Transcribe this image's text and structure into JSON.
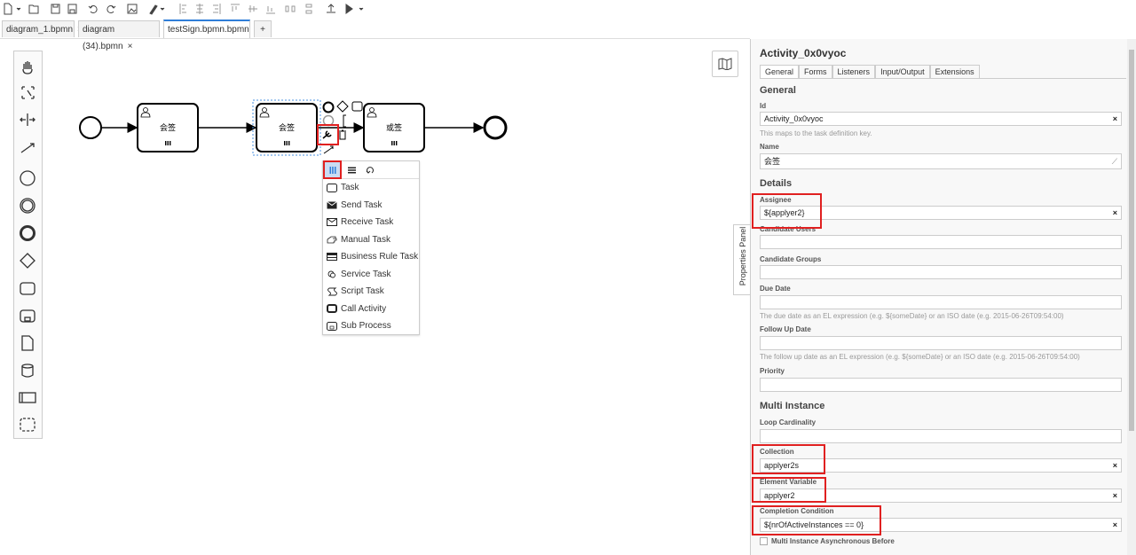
{
  "toolbar": {
    "icons": [
      "new-file-icon",
      "chevron-down-icon",
      "open-folder-icon",
      "save-icon",
      "save-as-icon",
      "undo-icon",
      "redo-icon",
      "export-image-icon",
      "edit-tool-icon",
      "chevron-down-icon",
      "align-left-icon",
      "align-center-icon",
      "align-right-icon",
      "align-top-icon",
      "align-middle-icon",
      "align-bottom-icon",
      "distribute-horizontal-icon",
      "distribute-vertical-icon",
      "deploy-icon",
      "run-icon",
      "chevron-down-icon"
    ]
  },
  "tabs": [
    {
      "label": "diagram_1.bpmn",
      "close": "×"
    },
    {
      "label": "diagram (34).bpmn",
      "close": "×"
    },
    {
      "label": "testSign.bpmn.bpmn",
      "close": "×"
    }
  ],
  "add_tab": "+",
  "palette": [
    "hand-tool-icon",
    "lasso-tool-icon",
    "space-tool-icon",
    "connect-tool-icon",
    "start-event-icon",
    "intermediate-event-icon",
    "end-event-icon",
    "gateway-icon",
    "task-icon",
    "subprocess-icon",
    "data-object-icon",
    "data-store-icon",
    "pool-icon",
    "group-icon"
  ],
  "diagram": {
    "tasks": [
      {
        "label": "会签"
      },
      {
        "label": "会签"
      },
      {
        "label": "或签"
      }
    ]
  },
  "replace_menu": {
    "toggles": [
      "parallel-multi-instance-icon",
      "sequential-multi-instance-icon",
      "loop-icon"
    ],
    "items": [
      {
        "label": "Task",
        "icon": "task-icon"
      },
      {
        "label": "Send Task",
        "icon": "send-task-icon"
      },
      {
        "label": "Receive Task",
        "icon": "receive-task-icon"
      },
      {
        "label": "Manual Task",
        "icon": "manual-task-icon"
      },
      {
        "label": "Business Rule Task",
        "icon": "business-rule-task-icon"
      },
      {
        "label": "Service Task",
        "icon": "service-task-icon"
      },
      {
        "label": "Script Task",
        "icon": "script-task-icon"
      },
      {
        "label": "Call Activity",
        "icon": "call-activity-icon"
      },
      {
        "label": "Sub Process",
        "icon": "sub-process-icon"
      }
    ]
  },
  "properties_toggle": "Properties Panel",
  "panel": {
    "title": "Activity_0x0vyoc",
    "tabs": [
      "General",
      "Forms",
      "Listeners",
      "Input/Output",
      "Extensions"
    ],
    "general": {
      "heading": "General",
      "id_label": "Id",
      "id_value": "Activity_0x0vyoc",
      "id_hint": "This maps to the task definition key.",
      "name_label": "Name",
      "name_value": "会签"
    },
    "details": {
      "heading": "Details",
      "assignee_label": "Assignee",
      "assignee_value": "${applyer2}",
      "candidate_users_label": "Candidate Users",
      "candidate_users_value": "",
      "candidate_groups_label": "Candidate Groups",
      "candidate_groups_value": "",
      "due_date_label": "Due Date",
      "due_date_value": "",
      "due_date_hint": "The due date as an EL expression (e.g. ${someDate} or an ISO date (e.g. 2015-06-26T09:54:00)",
      "follow_up_label": "Follow Up Date",
      "follow_up_value": "",
      "follow_up_hint": "The follow up date as an EL expression (e.g. ${someDate} or an ISO date (e.g. 2015-06-26T09:54:00)",
      "priority_label": "Priority",
      "priority_value": ""
    },
    "multi": {
      "heading": "Multi Instance",
      "loop_label": "Loop Cardinality",
      "loop_value": "",
      "collection_label": "Collection",
      "collection_value": "applyer2s",
      "element_var_label": "Element Variable",
      "element_var_value": "applyer2",
      "completion_label": "Completion Condition",
      "completion_value": "${nrOfActiveInstances == 0}",
      "async_label": "Multi Instance Asynchronous Before"
    },
    "clear": "×"
  },
  "colors": {
    "highlight": "#e02020",
    "accent": "#2f7ed8"
  }
}
